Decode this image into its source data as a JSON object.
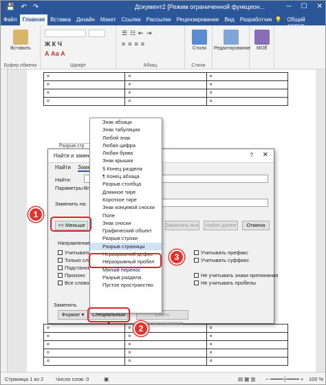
{
  "titlebar": {
    "title": "Документ2 [Режим ограниченной функцион...",
    "icons": [
      "save-icon",
      "undo-icon",
      "redo-icon"
    ],
    "controls": [
      "minimize-icon",
      "restore-icon",
      "close-icon"
    ]
  },
  "tabs": [
    "Файл",
    "Главная",
    "Вставка",
    "Дизайн",
    "Макет",
    "Ссылки",
    "Рассылки",
    "Рецензирование",
    "Вид",
    "Разработчик"
  ],
  "tabs_right": {
    "help": "💡",
    "share": "Общий доступ"
  },
  "ribbon": {
    "paste": "Вставить",
    "clipboard": "Буфер обмена",
    "font": "Шрифт",
    "paragraph": "Абзац",
    "styles": "Стили",
    "styles_label": "Стили",
    "editing": "Редактирование",
    "addin": "МОЁ",
    "font_buttons": "Ж К Ч",
    "font_buttons2": "А Аа А"
  },
  "document": {
    "page_break": "Разрыв стр",
    "cell": "¤"
  },
  "dialog": {
    "title": "Найти и заменить",
    "tab_find": "Найти",
    "tab_replace": "Замени",
    "find_label": "Найти:",
    "params_label": "Параметры:",
    "params_value": "Вп",
    "replace_label": "Заменить на:",
    "less_button": "<< Меньше",
    "replace_all": "Заменить все",
    "find_next": "Найти далее",
    "cancel": "Отмена",
    "direction_label": "Направление:",
    "left_checks": [
      "Учитывать р",
      "Только слова",
      "Подстанов",
      "Произно",
      "Все словоф"
    ],
    "right_checks": [
      "Учитывать префикс",
      "Учитывать суффикс",
      "Не учитывать знаки препинания",
      "Не учитывать пробелы"
    ],
    "replace_section": "Заменить",
    "format_button": "Формат ▾",
    "special_button": "Специальный ▾",
    "no_format_button": "Снять форматирование"
  },
  "menu": {
    "items": [
      "Знак абзаца",
      "Знак табуляции",
      "Любой знак",
      "Любая цифра",
      "Любая буква",
      "Знак крышки",
      "§ Конец раздела",
      "¶ Конец абзаца",
      "Разрыв столбца",
      "Длинное тире",
      "Короткое тире",
      "Знак концевой сноски",
      "Поле",
      "Знак сноски",
      "Графический объект",
      "Разрыв строки",
      "Разрыв страницы",
      "Неразрывный дефис",
      "Неразрывный пробел",
      "Мягкий перенос",
      "Разрыв раздела",
      "Пустое пространство"
    ],
    "highlighted_index": 16
  },
  "callouts": {
    "one": "1",
    "two": "2",
    "three": "3"
  },
  "status": {
    "page": "Страница 1 из 2",
    "words": "Число слов: 0",
    "zoom": "100 %"
  }
}
